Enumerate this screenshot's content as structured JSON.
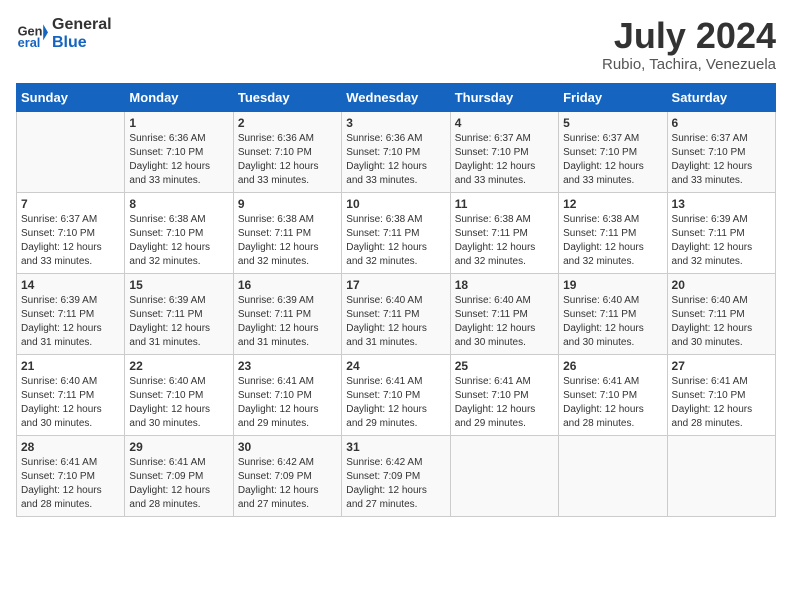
{
  "header": {
    "logo_line1": "General",
    "logo_line2": "Blue",
    "month_year": "July 2024",
    "location": "Rubio, Tachira, Venezuela"
  },
  "weekdays": [
    "Sunday",
    "Monday",
    "Tuesday",
    "Wednesday",
    "Thursday",
    "Friday",
    "Saturday"
  ],
  "weeks": [
    [
      {
        "day": "",
        "sunrise": "",
        "sunset": "",
        "daylight": ""
      },
      {
        "day": "1",
        "sunrise": "Sunrise: 6:36 AM",
        "sunset": "Sunset: 7:10 PM",
        "daylight": "Daylight: 12 hours and 33 minutes."
      },
      {
        "day": "2",
        "sunrise": "Sunrise: 6:36 AM",
        "sunset": "Sunset: 7:10 PM",
        "daylight": "Daylight: 12 hours and 33 minutes."
      },
      {
        "day": "3",
        "sunrise": "Sunrise: 6:36 AM",
        "sunset": "Sunset: 7:10 PM",
        "daylight": "Daylight: 12 hours and 33 minutes."
      },
      {
        "day": "4",
        "sunrise": "Sunrise: 6:37 AM",
        "sunset": "Sunset: 7:10 PM",
        "daylight": "Daylight: 12 hours and 33 minutes."
      },
      {
        "day": "5",
        "sunrise": "Sunrise: 6:37 AM",
        "sunset": "Sunset: 7:10 PM",
        "daylight": "Daylight: 12 hours and 33 minutes."
      },
      {
        "day": "6",
        "sunrise": "Sunrise: 6:37 AM",
        "sunset": "Sunset: 7:10 PM",
        "daylight": "Daylight: 12 hours and 33 minutes."
      }
    ],
    [
      {
        "day": "7",
        "sunrise": "Sunrise: 6:37 AM",
        "sunset": "Sunset: 7:10 PM",
        "daylight": "Daylight: 12 hours and 33 minutes."
      },
      {
        "day": "8",
        "sunrise": "Sunrise: 6:38 AM",
        "sunset": "Sunset: 7:10 PM",
        "daylight": "Daylight: 12 hours and 32 minutes."
      },
      {
        "day": "9",
        "sunrise": "Sunrise: 6:38 AM",
        "sunset": "Sunset: 7:11 PM",
        "daylight": "Daylight: 12 hours and 32 minutes."
      },
      {
        "day": "10",
        "sunrise": "Sunrise: 6:38 AM",
        "sunset": "Sunset: 7:11 PM",
        "daylight": "Daylight: 12 hours and 32 minutes."
      },
      {
        "day": "11",
        "sunrise": "Sunrise: 6:38 AM",
        "sunset": "Sunset: 7:11 PM",
        "daylight": "Daylight: 12 hours and 32 minutes."
      },
      {
        "day": "12",
        "sunrise": "Sunrise: 6:38 AM",
        "sunset": "Sunset: 7:11 PM",
        "daylight": "Daylight: 12 hours and 32 minutes."
      },
      {
        "day": "13",
        "sunrise": "Sunrise: 6:39 AM",
        "sunset": "Sunset: 7:11 PM",
        "daylight": "Daylight: 12 hours and 32 minutes."
      }
    ],
    [
      {
        "day": "14",
        "sunrise": "Sunrise: 6:39 AM",
        "sunset": "Sunset: 7:11 PM",
        "daylight": "Daylight: 12 hours and 31 minutes."
      },
      {
        "day": "15",
        "sunrise": "Sunrise: 6:39 AM",
        "sunset": "Sunset: 7:11 PM",
        "daylight": "Daylight: 12 hours and 31 minutes."
      },
      {
        "day": "16",
        "sunrise": "Sunrise: 6:39 AM",
        "sunset": "Sunset: 7:11 PM",
        "daylight": "Daylight: 12 hours and 31 minutes."
      },
      {
        "day": "17",
        "sunrise": "Sunrise: 6:40 AM",
        "sunset": "Sunset: 7:11 PM",
        "daylight": "Daylight: 12 hours and 31 minutes."
      },
      {
        "day": "18",
        "sunrise": "Sunrise: 6:40 AM",
        "sunset": "Sunset: 7:11 PM",
        "daylight": "Daylight: 12 hours and 30 minutes."
      },
      {
        "day": "19",
        "sunrise": "Sunrise: 6:40 AM",
        "sunset": "Sunset: 7:11 PM",
        "daylight": "Daylight: 12 hours and 30 minutes."
      },
      {
        "day": "20",
        "sunrise": "Sunrise: 6:40 AM",
        "sunset": "Sunset: 7:11 PM",
        "daylight": "Daylight: 12 hours and 30 minutes."
      }
    ],
    [
      {
        "day": "21",
        "sunrise": "Sunrise: 6:40 AM",
        "sunset": "Sunset: 7:11 PM",
        "daylight": "Daylight: 12 hours and 30 minutes."
      },
      {
        "day": "22",
        "sunrise": "Sunrise: 6:40 AM",
        "sunset": "Sunset: 7:10 PM",
        "daylight": "Daylight: 12 hours and 30 minutes."
      },
      {
        "day": "23",
        "sunrise": "Sunrise: 6:41 AM",
        "sunset": "Sunset: 7:10 PM",
        "daylight": "Daylight: 12 hours and 29 minutes."
      },
      {
        "day": "24",
        "sunrise": "Sunrise: 6:41 AM",
        "sunset": "Sunset: 7:10 PM",
        "daylight": "Daylight: 12 hours and 29 minutes."
      },
      {
        "day": "25",
        "sunrise": "Sunrise: 6:41 AM",
        "sunset": "Sunset: 7:10 PM",
        "daylight": "Daylight: 12 hours and 29 minutes."
      },
      {
        "day": "26",
        "sunrise": "Sunrise: 6:41 AM",
        "sunset": "Sunset: 7:10 PM",
        "daylight": "Daylight: 12 hours and 28 minutes."
      },
      {
        "day": "27",
        "sunrise": "Sunrise: 6:41 AM",
        "sunset": "Sunset: 7:10 PM",
        "daylight": "Daylight: 12 hours and 28 minutes."
      }
    ],
    [
      {
        "day": "28",
        "sunrise": "Sunrise: 6:41 AM",
        "sunset": "Sunset: 7:10 PM",
        "daylight": "Daylight: 12 hours and 28 minutes."
      },
      {
        "day": "29",
        "sunrise": "Sunrise: 6:41 AM",
        "sunset": "Sunset: 7:09 PM",
        "daylight": "Daylight: 12 hours and 28 minutes."
      },
      {
        "day": "30",
        "sunrise": "Sunrise: 6:42 AM",
        "sunset": "Sunset: 7:09 PM",
        "daylight": "Daylight: 12 hours and 27 minutes."
      },
      {
        "day": "31",
        "sunrise": "Sunrise: 6:42 AM",
        "sunset": "Sunset: 7:09 PM",
        "daylight": "Daylight: 12 hours and 27 minutes."
      },
      {
        "day": "",
        "sunrise": "",
        "sunset": "",
        "daylight": ""
      },
      {
        "day": "",
        "sunrise": "",
        "sunset": "",
        "daylight": ""
      },
      {
        "day": "",
        "sunrise": "",
        "sunset": "",
        "daylight": ""
      }
    ]
  ]
}
